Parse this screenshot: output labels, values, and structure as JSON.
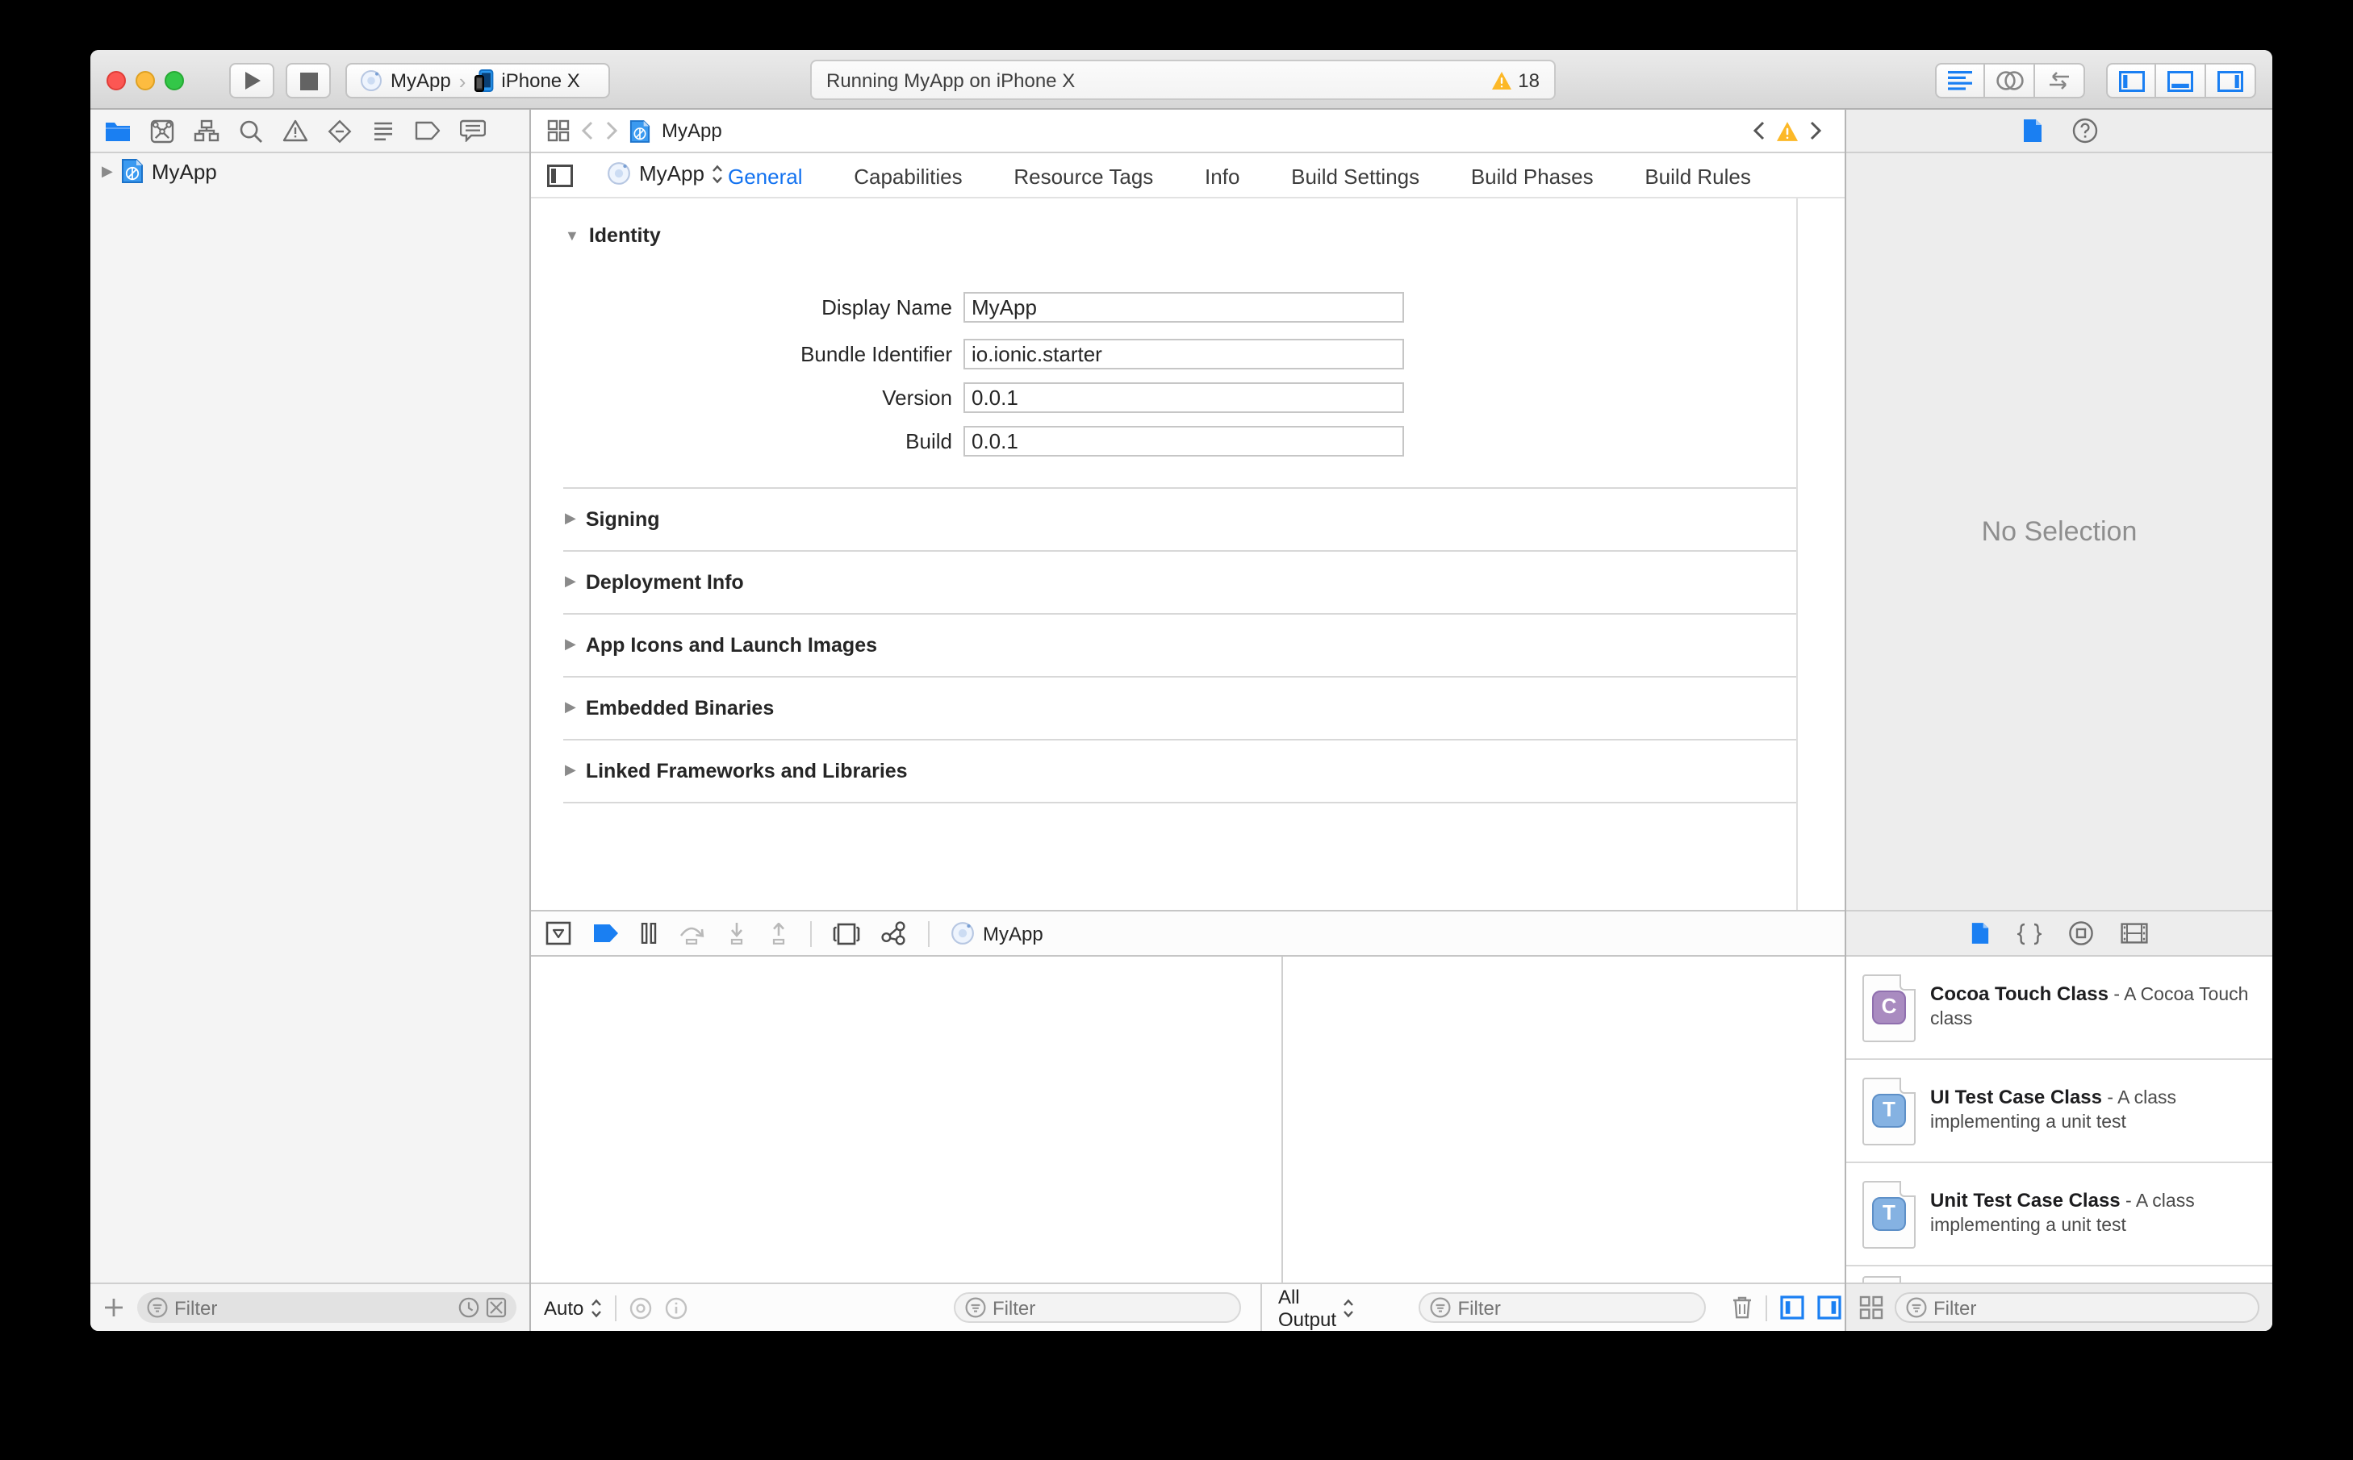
{
  "toolbar": {
    "scheme_project": "MyApp",
    "scheme_device": "iPhone X",
    "status_message": "Running MyApp on iPhone X",
    "warning_count": "18"
  },
  "navigator": {
    "project_name": "MyApp",
    "filter_placeholder": "Filter"
  },
  "jump_bar": {
    "current_item": "MyApp"
  },
  "editor": {
    "target_popup": "MyApp",
    "tabs": [
      "General",
      "Capabilities",
      "Resource Tags",
      "Info",
      "Build Settings",
      "Build Phases",
      "Build Rules"
    ],
    "selected_tab": "General",
    "identity_title": "Identity",
    "fields": [
      {
        "label": "Display Name",
        "value": "MyApp"
      },
      {
        "label": "Bundle Identifier",
        "value": "io.ionic.starter"
      },
      {
        "label": "Version",
        "value": "0.0.1"
      },
      {
        "label": "Build",
        "value": "0.0.1"
      }
    ],
    "sections": [
      "Signing",
      "Deployment Info",
      "App Icons and Launch Images",
      "Embedded Binaries",
      "Linked Frameworks and Libraries"
    ]
  },
  "debug": {
    "target_name": "MyApp",
    "variables_scope": "Auto",
    "console_scope": "All Output",
    "filter_placeholder": "Filter"
  },
  "utilities": {
    "empty_state": "No Selection",
    "filter_placeholder": "Filter",
    "library": [
      {
        "title": "Cocoa Touch Class",
        "desc": " - A Cocoa Touch class",
        "badge": "C"
      },
      {
        "title": "UI Test Case Class",
        "desc": " - A class implementing a unit test",
        "badge": "T"
      },
      {
        "title": "Unit Test Case Class",
        "desc": " - A class implementing a unit test",
        "badge": "T"
      }
    ]
  },
  "colors": {
    "accent": "#1a7ff2",
    "warning": "#fcb827"
  }
}
